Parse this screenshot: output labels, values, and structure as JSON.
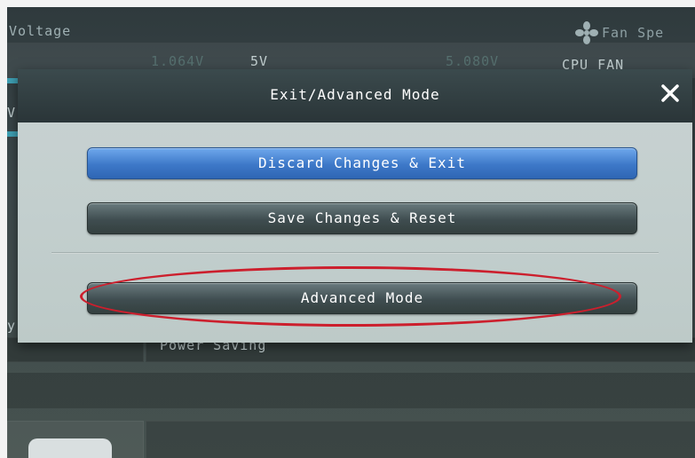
{
  "background": {
    "voltage_label": "Voltage",
    "voltage_value_1": "1.064V",
    "voltage_5v_label": "5V",
    "voltage_value_2": "5.080V",
    "fan_label": "Fan Spe",
    "cpu_fan_label": "CPU_FAN",
    "power_saving_label": "Power Saving",
    "left_edge_letter_1": "V",
    "left_edge_letter_2": "y"
  },
  "dialog": {
    "title": "Exit/Advanced Mode",
    "close_icon": "close-icon",
    "buttons": {
      "discard": "Discard Changes & Exit",
      "save": "Save Changes & Reset",
      "advanced": "Advanced Mode"
    }
  },
  "colors": {
    "primary_button": "#3d78c8",
    "dark_button": "#3f4d50",
    "highlight": "#cc1f2d",
    "dialog_body": "#c3cfce"
  }
}
